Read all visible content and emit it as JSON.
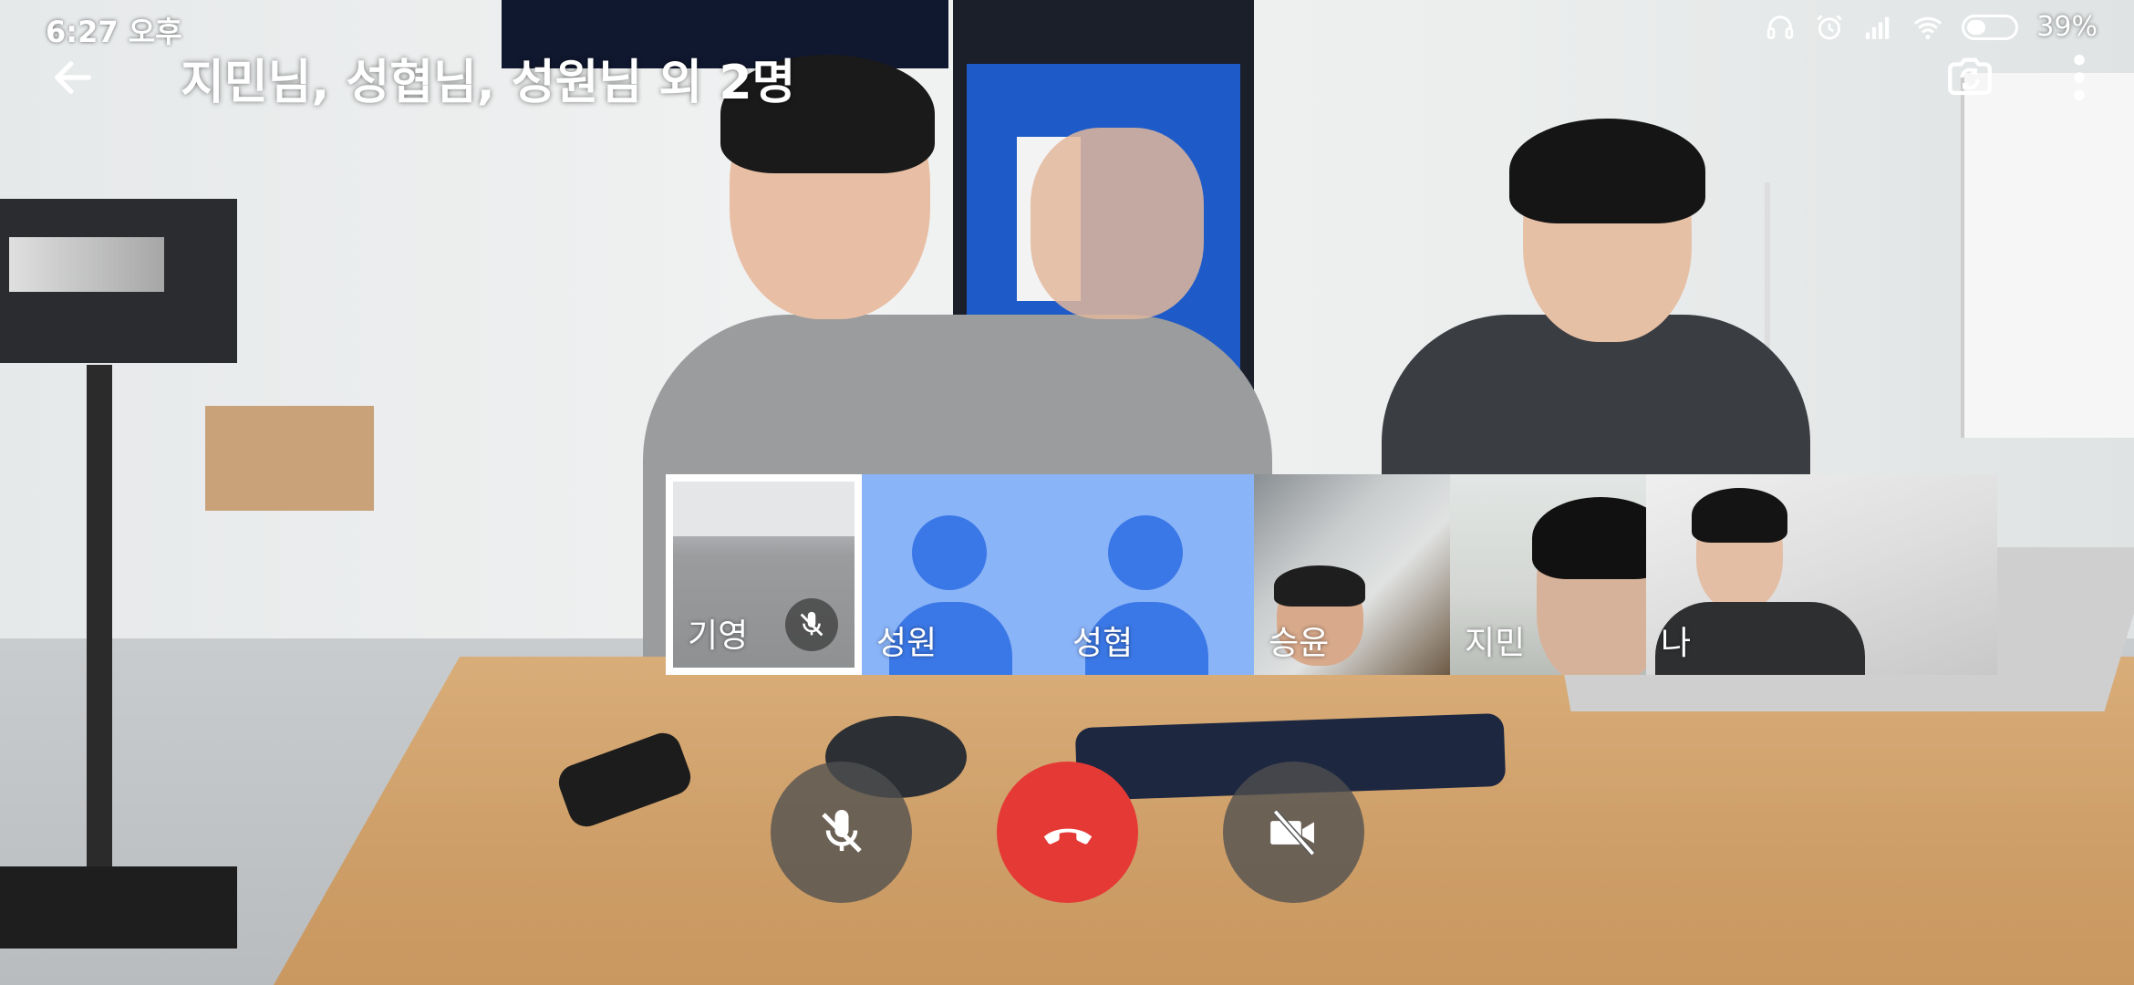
{
  "status_bar": {
    "time": "6:27 오후",
    "battery_percent": "39%",
    "battery_level": 0.39,
    "icons": [
      "headset-icon",
      "alarm-icon",
      "signal-icon",
      "wifi-icon",
      "battery-icon"
    ]
  },
  "app_bar": {
    "title": "지민님, 성협님, 성원님 외 2명",
    "back_icon": "arrow-back-icon",
    "switch_camera_icon": "switch-camera-icon",
    "more_icon": "more-vert-icon"
  },
  "participants": [
    {
      "name": "기영",
      "type": "video",
      "selected": true,
      "muted": true
    },
    {
      "name": "성원",
      "type": "avatar"
    },
    {
      "name": "성협",
      "type": "avatar"
    },
    {
      "name": "승윤",
      "type": "video"
    },
    {
      "name": "지민",
      "type": "video"
    },
    {
      "name": "나",
      "type": "video",
      "self": true
    }
  ],
  "controls": {
    "mic": "mic-off-icon",
    "end_call": "call-end-icon",
    "camera": "videocam-off-icon"
  },
  "colors": {
    "end_call": "#e53935",
    "avatar_bg": "#8ab4f8",
    "avatar_fg": "#3b78e7"
  }
}
